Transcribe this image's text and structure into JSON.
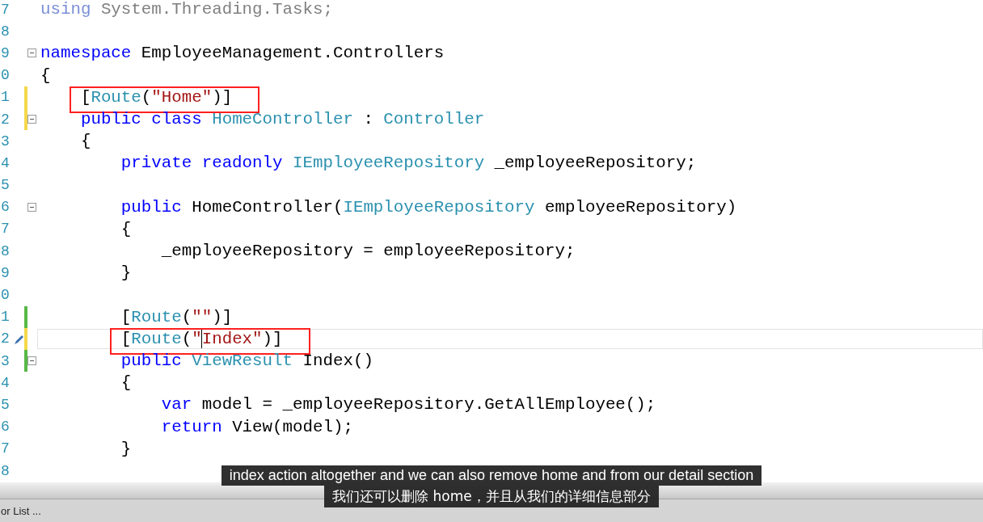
{
  "editor": {
    "lines": [
      {
        "number": "7",
        "tokens": [
          {
            "text": "using",
            "kind": "faded-keyword"
          },
          {
            "text": " System.Threading.Tasks;",
            "kind": "faded"
          }
        ]
      },
      {
        "number": "8"
      },
      {
        "number": "9",
        "foldable": true,
        "tokens": [
          {
            "text": "namespace",
            "kind": "keyword"
          },
          {
            "text": " EmployeeManagement.Controllers",
            "kind": "plain"
          }
        ]
      },
      {
        "number": "0",
        "tokens": [
          {
            "text": "{",
            "kind": "plain"
          }
        ]
      },
      {
        "number": "1",
        "color": "#f3d84c",
        "boxed": true,
        "tokens": [
          {
            "text": "    [",
            "kind": "plain"
          },
          {
            "text": "Route",
            "kind": "type"
          },
          {
            "text": "(",
            "kind": "plain"
          },
          {
            "text": "\"Home\"",
            "kind": "string"
          },
          {
            "text": ")]",
            "kind": "plain"
          }
        ]
      },
      {
        "number": "2",
        "color": "#f3d84c",
        "foldable": true,
        "tokens": [
          {
            "text": "    public class ",
            "kind": "keyword"
          },
          {
            "text": "HomeController",
            "kind": "type"
          },
          {
            "text": " : ",
            "kind": "plain"
          },
          {
            "text": "Controller",
            "kind": "type"
          }
        ]
      },
      {
        "number": "3",
        "tokens": [
          {
            "text": "    {",
            "kind": "plain"
          }
        ]
      },
      {
        "number": "4",
        "tokens": [
          {
            "text": "        private readonly ",
            "kind": "keyword"
          },
          {
            "text": "IEmployeeRepository",
            "kind": "type"
          },
          {
            "text": " _employeeRepository;",
            "kind": "plain"
          }
        ]
      },
      {
        "number": "5"
      },
      {
        "number": "6",
        "foldable": true,
        "tokens": [
          {
            "text": "        public",
            "kind": "keyword"
          },
          {
            "text": " HomeController(",
            "kind": "plain"
          },
          {
            "text": "IEmployeeRepository",
            "kind": "type"
          },
          {
            "text": " employeeRepository)",
            "kind": "plain"
          }
        ]
      },
      {
        "number": "7",
        "tokens": [
          {
            "text": "        {",
            "kind": "plain"
          }
        ]
      },
      {
        "number": "8",
        "tokens": [
          {
            "text": "            _employeeRepository = employeeRepository;",
            "kind": "plain"
          }
        ]
      },
      {
        "number": "9",
        "tokens": [
          {
            "text": "        }",
            "kind": "plain"
          }
        ]
      },
      {
        "number": "0"
      },
      {
        "number": "1",
        "color": "#57b847",
        "tokens": [
          {
            "text": "        [",
            "kind": "plain"
          },
          {
            "text": "Route",
            "kind": "type"
          },
          {
            "text": "(",
            "kind": "plain"
          },
          {
            "text": "\"\"",
            "kind": "string"
          },
          {
            "text": ")]",
            "kind": "plain"
          }
        ]
      },
      {
        "number": "2",
        "color": "#f3d84c",
        "current": true,
        "boxed": true,
        "tokens": [
          {
            "text": "        [",
            "kind": "plain"
          },
          {
            "text": "Route",
            "kind": "type"
          },
          {
            "text": "(",
            "kind": "plain"
          },
          {
            "text": "\"",
            "kind": "string"
          },
          {
            "text": "Index\"",
            "kind": "string",
            "caret": true
          },
          {
            "text": ")]",
            "kind": "plain"
          }
        ]
      },
      {
        "number": "3",
        "color": "#57b847",
        "foldable": true,
        "tokens": [
          {
            "text": "        public ",
            "kind": "keyword"
          },
          {
            "text": "ViewResult",
            "kind": "type"
          },
          {
            "text": " Index()",
            "kind": "plain"
          }
        ]
      },
      {
        "number": "4",
        "tokens": [
          {
            "text": "        {",
            "kind": "plain"
          }
        ]
      },
      {
        "number": "5",
        "tokens": [
          {
            "text": "            var",
            "kind": "keyword"
          },
          {
            "text": " model = _employeeRepository.GetAllEmployee();",
            "kind": "plain"
          }
        ]
      },
      {
        "number": "6",
        "tokens": [
          {
            "text": "            return",
            "kind": "keyword"
          },
          {
            "text": " View(model);",
            "kind": "plain"
          }
        ]
      },
      {
        "number": "7",
        "tokens": [
          {
            "text": "        }",
            "kind": "plain"
          }
        ]
      },
      {
        "number": "8"
      }
    ]
  },
  "status_bar": {
    "text": "or List ..."
  },
  "subtitles": [
    "index action altogether and we can also remove home and from our detail section",
    "我们还可以删除 home，并且从我们的详细信息部分"
  ]
}
